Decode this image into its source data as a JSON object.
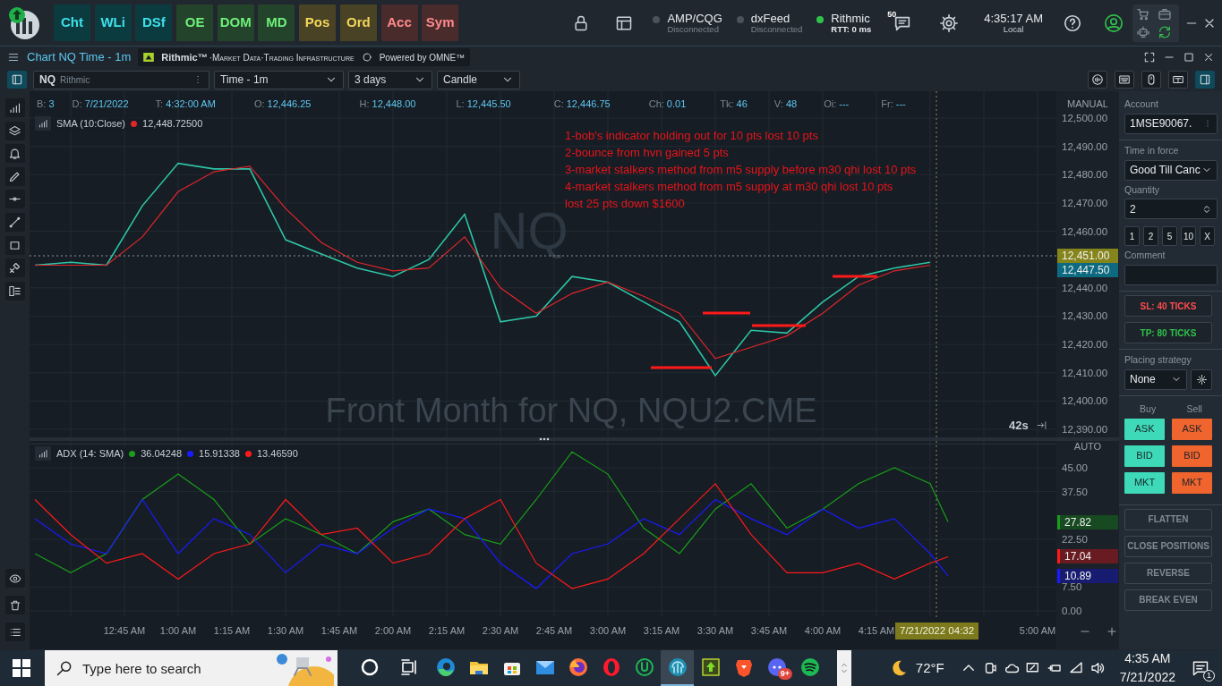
{
  "top_bar": {
    "tiles": [
      {
        "label": "Cht",
        "kind": "chart"
      },
      {
        "label": "WLi",
        "kind": "chart"
      },
      {
        "label": "DSf",
        "kind": "chart"
      },
      {
        "label": "OE",
        "kind": "order"
      },
      {
        "label": "DOM",
        "kind": "order"
      },
      {
        "label": "MD",
        "kind": "order"
      },
      {
        "label": "Pos",
        "kind": "position"
      },
      {
        "label": "Ord",
        "kind": "position"
      },
      {
        "label": "Acc",
        "kind": "account"
      },
      {
        "label": "Sym",
        "kind": "account"
      }
    ],
    "connections": [
      {
        "name": "AMP/CQG",
        "status": "Disconnected",
        "connected": false
      },
      {
        "name": "dxFeed",
        "status": "Disconnected",
        "connected": false
      },
      {
        "name": "Rithmic",
        "status": "RTT: 0 ms",
        "connected": true
      }
    ],
    "messages_count": "50",
    "clock": {
      "time": "4:35:17 AM",
      "zone": "Local"
    }
  },
  "chart_window": {
    "title": "Chart NQ Time - 1m",
    "banner": {
      "brand": "Rithmic™",
      "tagline": "·Market Data·Trading Infrastructure",
      "powered": "Powered by OMNE™"
    }
  },
  "toolbar": {
    "symbol": "NQ",
    "feed": "Rithmic",
    "dropdowns": [
      "Time - 1m",
      "3 days",
      "Candle"
    ]
  },
  "info_bar": [
    {
      "label": "B:",
      "value": "3"
    },
    {
      "label": "D:",
      "value": "7/21/2022"
    },
    {
      "label": "T:",
      "value": "4:32:00 AM"
    },
    {
      "label": "O:",
      "value": "12,446.25"
    },
    {
      "label": "H:",
      "value": "12,448.00"
    },
    {
      "label": "L:",
      "value": "12,445.50"
    },
    {
      "label": "C:",
      "value": "12,446.75"
    },
    {
      "label": "Ch:",
      "value": "0.01"
    },
    {
      "label": "Tk:",
      "value": "46"
    },
    {
      "label": "V:",
      "value": "48"
    },
    {
      "label": "Oi:",
      "value": "---"
    },
    {
      "label": "Fr:",
      "value": "---"
    }
  ],
  "price_pane": {
    "legend": {
      "name": "SMA (10:Close)",
      "color": "#e0262b",
      "value": "12,448.72500"
    },
    "watermark": {
      "symbol": "NQ",
      "description": "Front Month for NQ, NQU2.CME"
    },
    "notes": [
      "1-bob's indicator holding out for 10 pts lost 10 pts",
      "2-bounce from hvn gained 5 pts",
      "3-market stalkers method from m5 supply before m30 qhi lost 10 pts",
      "4-market stalkers method from m5 supply at m30 qhi lost 10 pts",
      "lost 25 pts down $1600"
    ],
    "scale_mode": "MANUAL",
    "timer": "42s",
    "price_markers": [
      {
        "text": "12,451.00",
        "color": "#85851c"
      },
      {
        "text": "12,447.50",
        "color": "#0e6a80"
      }
    ],
    "chart_data": {
      "type": "line",
      "x": [
        20,
        30,
        40,
        50,
        60,
        70,
        80,
        90,
        100,
        110,
        120,
        130,
        140,
        150,
        160,
        170,
        180,
        190,
        200,
        210,
        220,
        230,
        240,
        250,
        260,
        270
      ],
      "series": [
        {
          "color": "#2ec4a6",
          "values": [
            12448,
            12449,
            12448,
            12469,
            12484,
            12482,
            12482,
            12457,
            12452,
            12447,
            12444,
            12450,
            12466,
            12428,
            12430,
            12444,
            12442,
            12435,
            12428,
            12409,
            12425,
            12424,
            12435,
            12444,
            12447,
            12449
          ]
        },
        {
          "color": "#e0262b",
          "values": [
            12448,
            12448,
            12448,
            12458,
            12474,
            12481,
            12483,
            12468,
            12456,
            12449,
            12446,
            12447,
            12458,
            12440,
            12431,
            12438,
            12442,
            12437,
            12431,
            12415,
            12419,
            12423,
            12431,
            12441,
            12446,
            12448
          ]
        }
      ],
      "xlim": [
        19,
        305
      ],
      "ylim": [
        12390,
        12500
      ],
      "grid": true,
      "yticks": [
        {
          "value": 12390,
          "label": "12,390.00"
        },
        {
          "value": 12400,
          "label": "12,400.00"
        },
        {
          "value": 12410,
          "label": "12,410.00"
        },
        {
          "value": 12420,
          "label": "12,420.00"
        },
        {
          "value": 12430,
          "label": "12,430.00"
        },
        {
          "value": 12440,
          "label": "12,440.00"
        },
        {
          "value": 12460,
          "label": "12,460.00"
        },
        {
          "value": 12470,
          "label": "12,470.00"
        },
        {
          "value": 12480,
          "label": "12,480.00"
        },
        {
          "value": 12490,
          "label": "12,490.00"
        },
        {
          "value": 12500,
          "label": "12,500.00"
        }
      ]
    }
  },
  "adx_pane": {
    "legend": {
      "name": "ADX (14: SMA)",
      "lines": [
        {
          "color": "#1a9e1a",
          "value": "36.04248"
        },
        {
          "color": "#1a1aff",
          "value": "15.91338"
        },
        {
          "color": "#ff1a1a",
          "value": "13.46590"
        }
      ]
    },
    "scale_mode": "AUTO",
    "value_markers": [
      {
        "text": "27.82",
        "color": "#1a9e1a"
      },
      {
        "text": "17.04",
        "color": "#ff1a1a"
      },
      {
        "text": "10.89",
        "color": "#1a1aff"
      }
    ],
    "cursor_time": "7/21/2022 04:32",
    "chart_data": {
      "type": "line",
      "x": [
        20,
        30,
        40,
        50,
        60,
        70,
        80,
        90,
        100,
        110,
        120,
        130,
        140,
        150,
        160,
        170,
        180,
        190,
        200,
        210,
        220,
        230,
        240,
        250,
        260,
        270,
        275
      ],
      "series": [
        {
          "color": "#1a9e1a",
          "values": [
            18,
            12,
            18,
            35,
            43,
            35,
            21,
            29,
            24,
            18,
            28,
            32,
            24,
            21,
            35,
            50,
            43,
            26,
            18,
            32,
            40,
            26,
            32,
            40,
            45,
            40,
            28
          ]
        },
        {
          "color": "#1a1aff",
          "values": [
            29,
            21,
            18,
            35,
            18,
            29,
            24,
            12,
            21,
            18,
            26,
            32,
            29,
            15,
            7,
            18,
            21,
            29,
            24,
            35,
            29,
            24,
            32,
            26,
            29,
            18,
            11
          ]
        },
        {
          "color": "#ff1a1a",
          "values": [
            35,
            24,
            15,
            18,
            10,
            18,
            21,
            35,
            24,
            26,
            15,
            18,
            29,
            35,
            15,
            7,
            10,
            18,
            29,
            40,
            24,
            12,
            12,
            15,
            10,
            15,
            17
          ]
        }
      ],
      "xlim": [
        19,
        305
      ],
      "ylim": [
        0,
        52.5
      ],
      "grid": true,
      "xticks": [
        {
          "value": 45,
          "label": "12:45 AM"
        },
        {
          "value": 60,
          "label": "1:00 AM"
        },
        {
          "value": 75,
          "label": "1:15 AM"
        },
        {
          "value": 90,
          "label": "1:30 AM"
        },
        {
          "value": 105,
          "label": "1:45 AM"
        },
        {
          "value": 120,
          "label": "2:00 AM"
        },
        {
          "value": 135,
          "label": "2:15 AM"
        },
        {
          "value": 150,
          "label": "2:30 AM"
        },
        {
          "value": 165,
          "label": "2:45 AM"
        },
        {
          "value": 180,
          "label": "3:00 AM"
        },
        {
          "value": 195,
          "label": "3:15 AM"
        },
        {
          "value": 210,
          "label": "3:30 AM"
        },
        {
          "value": 225,
          "label": "3:45 AM"
        },
        {
          "value": 240,
          "label": "4:00 AM"
        },
        {
          "value": 255,
          "label": "4:15 AM"
        },
        {
          "value": 300,
          "label": "5:00 AM"
        }
      ],
      "yticks": [
        {
          "value": 0,
          "label": "0.00"
        },
        {
          "value": 7.5,
          "label": "7.50"
        },
        {
          "value": 22.5,
          "label": "22.50"
        },
        {
          "value": 37.5,
          "label": "37.50"
        },
        {
          "value": 45,
          "label": "45.00"
        }
      ]
    }
  },
  "order_panel": {
    "account_label": "Account",
    "account": "1MSE90067.",
    "tif_label": "Time in force",
    "tif": "Good Till Canc",
    "quantity_label": "Quantity",
    "quantity": "2",
    "quick_quantities": [
      "1",
      "2",
      "5",
      "10",
      "X"
    ],
    "comment_label": "Comment",
    "stop_loss": "SL: 40 TICKS",
    "take_profit": "TP: 80 TICKS",
    "strategy_label": "Placing strategy",
    "strategy": "None",
    "buy_label": "Buy",
    "sell_label": "Sell",
    "buy_buttons": [
      "ASK",
      "BID",
      "MKT"
    ],
    "sell_buttons": [
      "ASK",
      "BID",
      "MKT"
    ],
    "actions": [
      "FLATTEN",
      "CLOSE POSITIONS",
      "REVERSE",
      "BREAK EVEN"
    ]
  },
  "taskbar": {
    "search_placeholder": "Type here to search",
    "apps": [
      {
        "kind": "cortana",
        "active": false
      },
      {
        "kind": "taskview",
        "active": false
      },
      {
        "kind": "edge",
        "active": false
      },
      {
        "kind": "explorer",
        "active": false
      },
      {
        "kind": "store",
        "active": false
      },
      {
        "kind": "mail",
        "active": false
      },
      {
        "kind": "firefox",
        "active": false
      },
      {
        "kind": "opera",
        "active": false
      },
      {
        "kind": "ring",
        "active": false
      },
      {
        "kind": "dome",
        "active": true
      },
      {
        "kind": "arrow",
        "active": false
      },
      {
        "kind": "brave",
        "active": false
      },
      {
        "kind": "discord",
        "active": false,
        "badge": "9+"
      },
      {
        "kind": "spotify",
        "active": false
      }
    ],
    "weather": "72°F",
    "time": "4:35 AM",
    "date": "7/21/2022",
    "notifications": "1"
  }
}
